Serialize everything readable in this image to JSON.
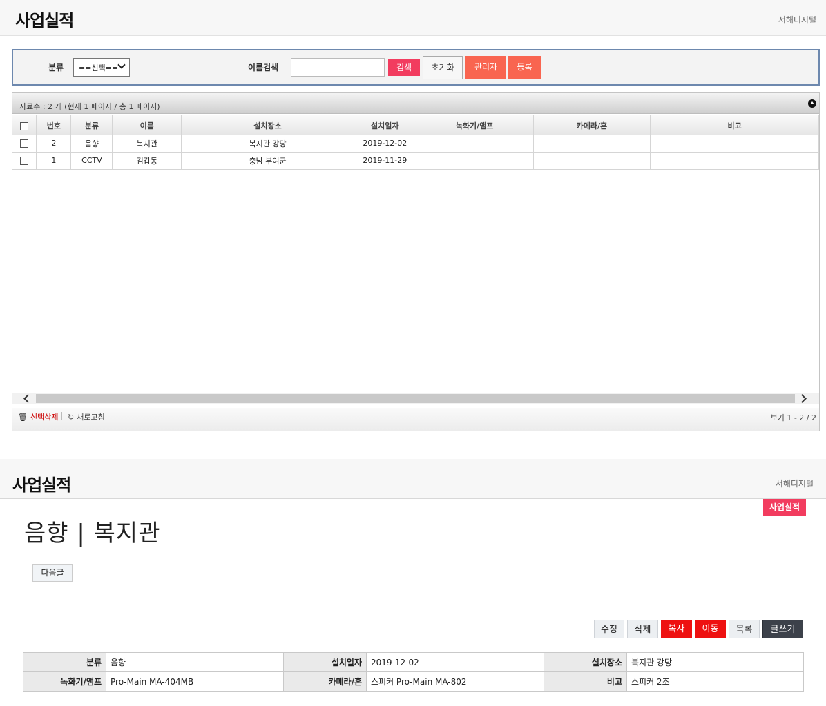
{
  "header": {
    "title": "사업실적",
    "company": "서해디지털"
  },
  "search": {
    "category_label": "분류",
    "category_value": "==선택==",
    "name_label": "이름검색",
    "name_value": "",
    "search_btn": "검색",
    "reset_btn": "초기화",
    "admin_btn": "관리자",
    "register_btn": "등록"
  },
  "grid": {
    "caption": "자료수 : 2 개 (현재 1 페이지 / 총 1 페이지)",
    "columns": [
      "",
      "번호",
      "분류",
      "이름",
      "설치장소",
      "설치일자",
      "녹화기/앰프",
      "카메라/혼",
      "비고"
    ],
    "rows": [
      {
        "no": "2",
        "category": "음향",
        "name": "복지관",
        "place": "복지관 강당",
        "date": "2019-12-02",
        "recorder": "",
        "camera": "",
        "note": ""
      },
      {
        "no": "1",
        "category": "CCTV",
        "name": "김갑동",
        "place": "충남 부여군",
        "date": "2019-11-29",
        "recorder": "",
        "camera": "",
        "note": ""
      }
    ],
    "delete_label": "선택삭제",
    "refresh_label": "새로고침",
    "view_info": "보기 1 - 2 / 2"
  },
  "detail": {
    "header_title": "사업실적",
    "company": "서해디지털",
    "badge": "사업실적",
    "post_title": "음향 | 복지관",
    "next_btn": "다음글",
    "actions": {
      "edit": "수정",
      "delete": "삭제",
      "copy": "복사",
      "move": "이동",
      "list": "목록",
      "write": "글쓰기"
    },
    "info": {
      "category_label": "분류",
      "category": "음향",
      "date_label": "설치일자",
      "date": "2019-12-02",
      "place_label": "설치장소",
      "place": "복지관 강당",
      "recorder_label": "녹화기/앰프",
      "recorder": "Pro-Main MA-404MB",
      "camera_label": "카메라/혼",
      "camera": "스피커 Pro-Main MA-802",
      "note_label": "비고",
      "note": "스피커 2조"
    }
  },
  "colors": {
    "accent_pink": "#f23c5f",
    "accent_orange": "#f96550",
    "accent_red": "#ee1111",
    "dark": "#3c414a"
  }
}
